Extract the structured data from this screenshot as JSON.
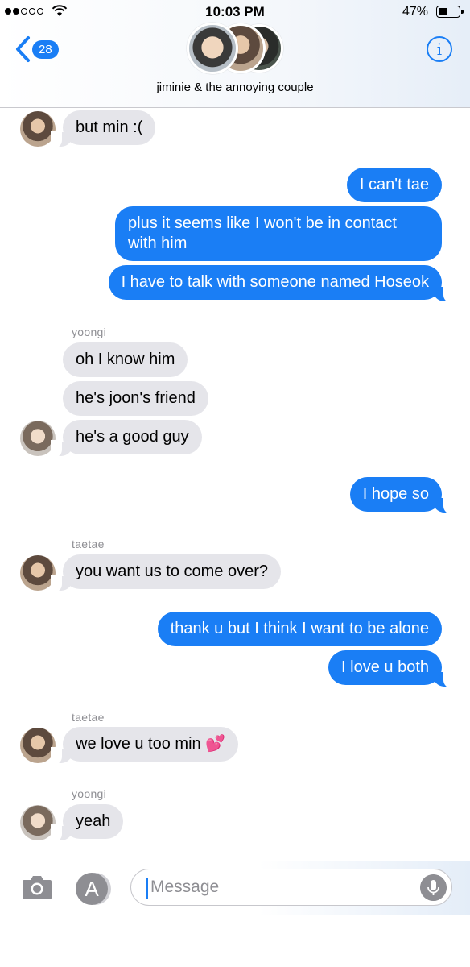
{
  "status_bar": {
    "time": "10:03 PM",
    "battery_percent": "47%",
    "battery_level": 0.47,
    "signal_bars_filled": 2,
    "signal_bars_total": 5
  },
  "header": {
    "back_badge": "28",
    "group_name": "jiminie & the annoying couple",
    "info_label": "i"
  },
  "messages": [
    {
      "from": "taetae",
      "text": "but min :("
    },
    {
      "from": "me",
      "text": "I can't tae"
    },
    {
      "from": "me",
      "text": "plus it seems like I won't be in contact with him"
    },
    {
      "from": "me",
      "text": "I have to talk with someone named Hoseok"
    },
    {
      "sender_label": "yoongi"
    },
    {
      "from": "yoongi",
      "text": "oh I know him"
    },
    {
      "from": "yoongi",
      "text": "he's joon's friend"
    },
    {
      "from": "yoongi",
      "text": "he's a good guy"
    },
    {
      "from": "me",
      "text": "I hope so"
    },
    {
      "sender_label": "taetae"
    },
    {
      "from": "taetae",
      "text": "you want us to come over?"
    },
    {
      "from": "me",
      "text": "thank u but I think I want to be alone"
    },
    {
      "from": "me",
      "text": "I love u both"
    },
    {
      "sender_label": "taetae"
    },
    {
      "from": "taetae",
      "text": "we love u too min 💕"
    },
    {
      "sender_label": "yoongi"
    },
    {
      "from": "yoongi",
      "text": "yeah"
    }
  ],
  "input": {
    "placeholder": "Message"
  },
  "icons": {
    "back": "chevron-left-icon",
    "info": "info-icon",
    "camera": "camera-icon",
    "apps": "app-store-icon",
    "mic": "microphone-icon"
  },
  "colors": {
    "accent": "#1a7ef5",
    "incoming_bubble": "#e5e5ea",
    "outgoing_bubble": "#1a7ef5",
    "sender_label": "#8e8e93"
  }
}
